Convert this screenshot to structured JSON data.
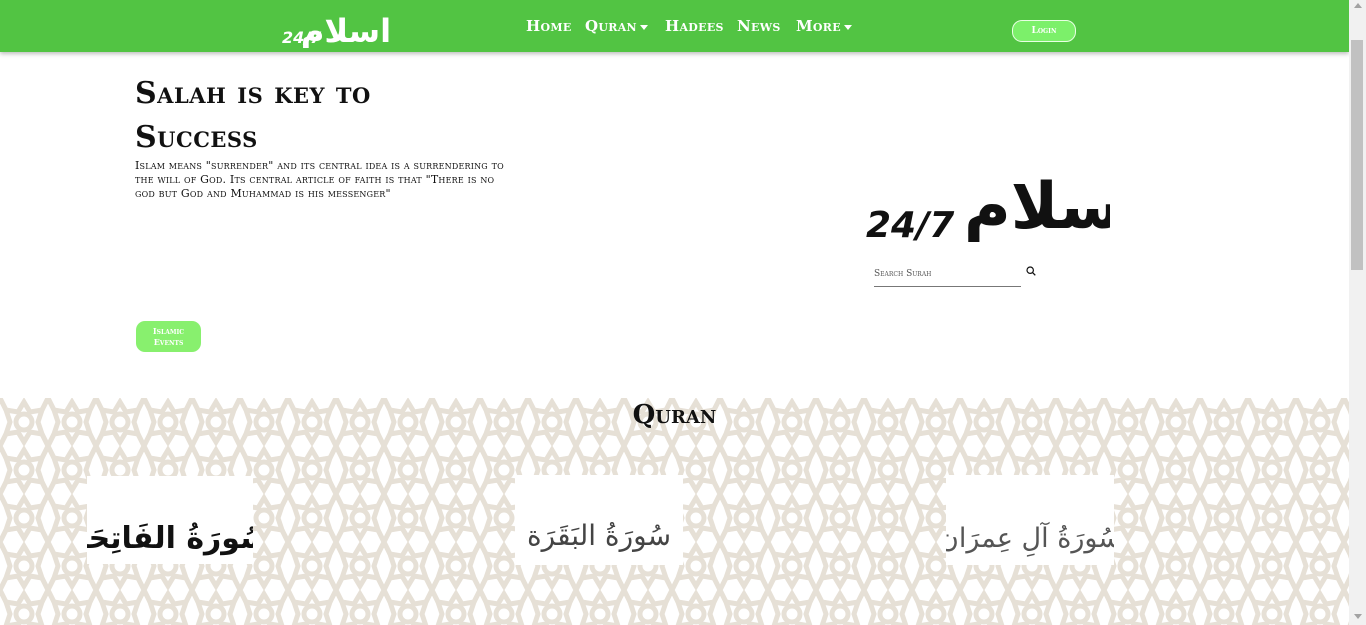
{
  "brand": {
    "logo_text": "24/7",
    "logo_mark": "اسلام"
  },
  "nav": {
    "items": [
      {
        "label": "Home",
        "dropdown": false
      },
      {
        "label": "Quran",
        "dropdown": true
      },
      {
        "label": "Hadees",
        "dropdown": false
      },
      {
        "label": "News",
        "dropdown": false
      },
      {
        "label": "More",
        "dropdown": true
      }
    ],
    "login_label": "Login"
  },
  "hero": {
    "title": "Salah is key to Success",
    "description": "Islam means \"surrender\" and its central idea is a surrendering to the will of God. Its central article of faith is that \"There is no god but God and Muhammad is his messenger\"",
    "events_button": "Islamic Events"
  },
  "search": {
    "placeholder": "Search Surah"
  },
  "quran": {
    "heading": "Quran",
    "surahs": [
      {
        "calligraphy": "سُورَةُ الفَاتِحَة"
      },
      {
        "calligraphy": "سُورَةُ البَقَرَة"
      },
      {
        "calligraphy": "سُورَةُ آلِ عِمرَان"
      }
    ]
  },
  "colors": {
    "nav_green": "#52c443",
    "button_green": "#88f06e",
    "pattern": "#e8e3db"
  },
  "icons": [
    "search-icon",
    "caret-down-icon",
    "logo-mark"
  ]
}
